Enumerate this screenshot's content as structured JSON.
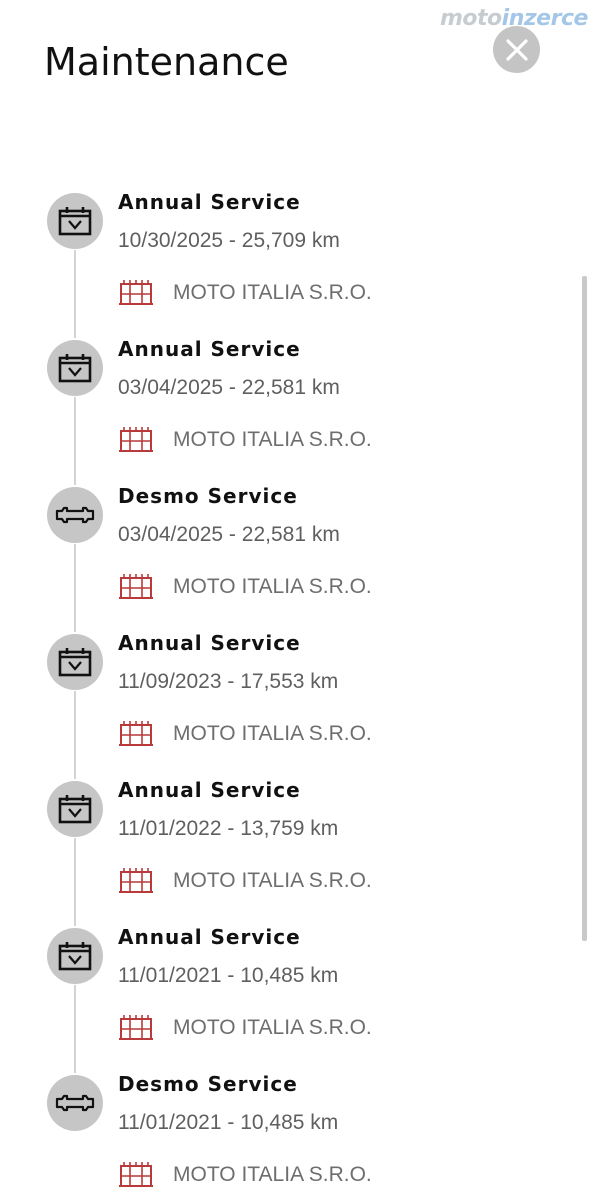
{
  "watermark": {
    "part1": "moto",
    "part2": "inzerce"
  },
  "header": {
    "title": "Maintenance",
    "close_icon": "close-icon"
  },
  "colors": {
    "accent": "#b83a3a",
    "circle": "#c6c6c6",
    "timeline_line": "#d3d3d3"
  },
  "entries": [
    {
      "title": "Annual Service",
      "meta": "10/30/2025 - 25,709 km",
      "dealer": "MOTO ITALIA S.R.O.",
      "icon": "calendar-check-icon"
    },
    {
      "title": "Annual Service",
      "meta": "03/04/2025 - 22,581 km",
      "dealer": "MOTO ITALIA S.R.O.",
      "icon": "calendar-check-icon"
    },
    {
      "title": "Desmo Service",
      "meta": "03/04/2025 - 22,581 km",
      "dealer": "MOTO ITALIA S.R.O.",
      "icon": "wrench-icon"
    },
    {
      "title": "Annual Service",
      "meta": "11/09/2023 - 17,553 km",
      "dealer": "MOTO ITALIA S.R.O.",
      "icon": "calendar-check-icon"
    },
    {
      "title": "Annual Service",
      "meta": "11/01/2022 - 13,759 km",
      "dealer": "MOTO ITALIA S.R.O.",
      "icon": "calendar-check-icon"
    },
    {
      "title": "Annual Service",
      "meta": "11/01/2021 - 10,485 km",
      "dealer": "MOTO ITALIA S.R.O.",
      "icon": "calendar-check-icon"
    },
    {
      "title": "Desmo Service",
      "meta": "11/01/2021 - 10,485 km",
      "dealer": "MOTO ITALIA S.R.O.",
      "icon": "wrench-icon"
    }
  ]
}
